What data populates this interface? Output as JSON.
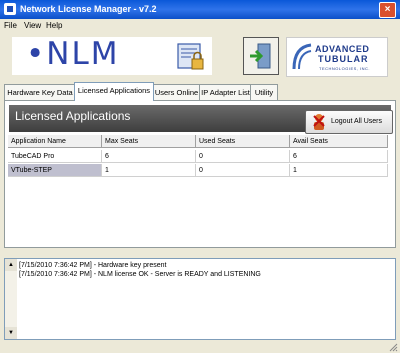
{
  "window": {
    "title": "Network License Manager - v7.2",
    "close_glyph": "×"
  },
  "menu": [
    "File",
    "View",
    "Help"
  ],
  "branding": {
    "nlm_logo_text": "•NLM",
    "advanced_tubular_logo": {
      "line1": "ADVANCED",
      "line2": "TUBULAR",
      "line3": "TECHNOLOGIES, INC."
    }
  },
  "tabs": [
    {
      "label": "Hardware Key Data",
      "active": false
    },
    {
      "label": "Licensed Applications",
      "active": true
    },
    {
      "label": "Users Online",
      "active": false
    },
    {
      "label": "IP Adapter List",
      "active": false
    },
    {
      "label": "Utility",
      "active": false
    }
  ],
  "panel": {
    "title": "Licensed Applications",
    "logout_label": "Logout All Users"
  },
  "table": {
    "columns": [
      "Application Name",
      "Max Seats",
      "Used Seats",
      "Avail Seats"
    ],
    "rows": [
      [
        "TubeCAD Pro",
        "6",
        "0",
        "6"
      ],
      [
        "VTube-STEP",
        "1",
        "0",
        "1"
      ]
    ],
    "selected_row": 1
  },
  "log": {
    "lines": [
      "[7/15/2010 7:36:42 PM] - Hardware key present",
      "[7/15/2010 7:36:42 PM] - NLM license OK - Server is READY and LISTENING"
    ],
    "scroll_up": "▲",
    "scroll_down": "▼"
  }
}
